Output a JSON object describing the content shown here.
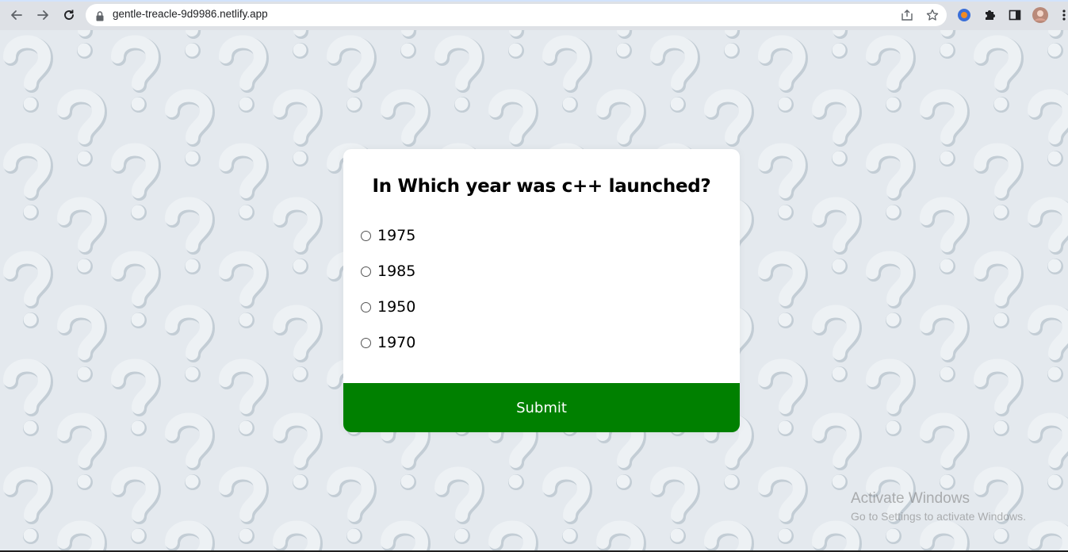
{
  "browser": {
    "url": "gentle-treacle-9d9986.netlify.app",
    "icons": [
      "back-icon",
      "forward-icon",
      "reload-icon",
      "lock-icon",
      "share-icon",
      "star-icon",
      "extension-shield-icon",
      "puzzle-icon",
      "side-panel-icon",
      "profile-avatar",
      "menu-icon"
    ]
  },
  "quiz": {
    "question": "In Which year was c++ launched?",
    "options": [
      {
        "label": "1975",
        "selected": false
      },
      {
        "label": "1985",
        "selected": false
      },
      {
        "label": "1950",
        "selected": false
      },
      {
        "label": "1970",
        "selected": false
      }
    ],
    "submit_label": "Submit"
  },
  "watermark": {
    "title": "Activate Windows",
    "subtitle": "Go to Settings to activate Windows."
  },
  "colors": {
    "submit_bg": "#008000",
    "page_bg": "#e4e9ee",
    "card_bg": "#ffffff"
  }
}
